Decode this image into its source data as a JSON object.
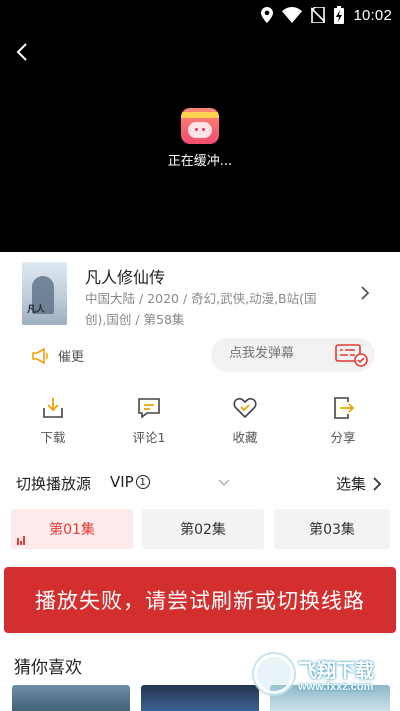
{
  "status_bar": {
    "time": "10:02",
    "icons": [
      "location-icon",
      "wifi-icon",
      "no-sim-icon",
      "battery-charging-icon"
    ]
  },
  "player": {
    "back_icon": "chevron-left-icon",
    "buffering_text": "正在缓冲..."
  },
  "show": {
    "title": "凡人修仙传",
    "meta": "中国大陆 / 2020 / 奇幻,武侠,动漫,B站(国创),国创 / 第58集",
    "poster_mark": "凡人"
  },
  "urge": {
    "label": "催更",
    "icon": "megaphone-icon"
  },
  "danmaku": {
    "placeholder": "点我发弹幕",
    "icon": "danmaku-settings-icon"
  },
  "actions": [
    {
      "label": "下载",
      "icon": "download-icon"
    },
    {
      "label": "评论1",
      "icon": "comment-icon"
    },
    {
      "label": "收藏",
      "icon": "heart-icon"
    },
    {
      "label": "分享",
      "icon": "share-icon"
    }
  ],
  "source": {
    "label": "切换播放源",
    "value": "VIP",
    "value_index": "1",
    "select_label": "选集"
  },
  "episodes": [
    {
      "label": "第01集",
      "active": true
    },
    {
      "label": "第02集",
      "active": false
    },
    {
      "label": "第03集",
      "active": false
    }
  ],
  "error_banner": "播放失败，请尝试刷新或切换线路",
  "recommend": {
    "title": "猜你喜欢"
  },
  "watermark": {
    "text": "飞翔下载",
    "url": "www.fxxz.com"
  },
  "colors": {
    "accent_red": "#e53935",
    "banner_red": "#d32f2f",
    "player_bg": "#000000"
  }
}
